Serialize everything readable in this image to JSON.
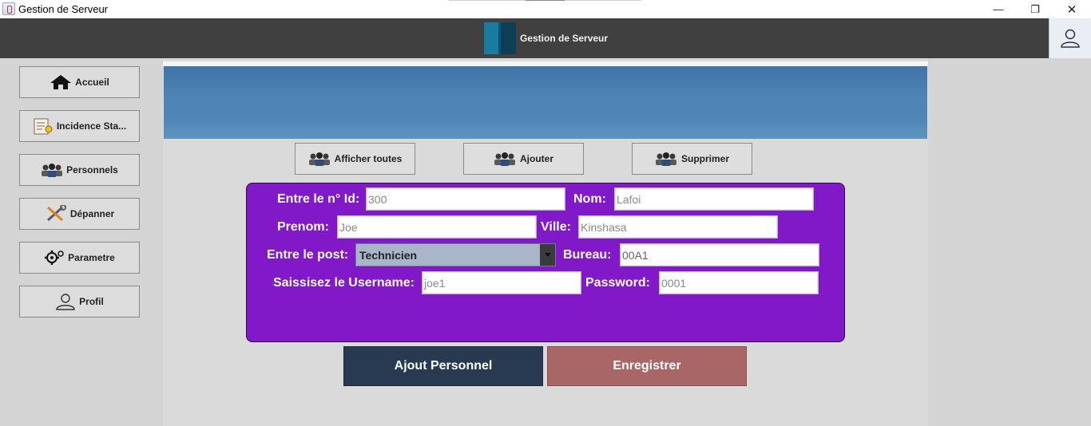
{
  "window": {
    "title": "Gestion de Serveur",
    "minimize_glyph": "—",
    "maximize_glyph": "❐",
    "close_glyph": "✕"
  },
  "header": {
    "title": "Gestion de Serveur"
  },
  "sidebar": {
    "items": [
      {
        "label": "Accueil",
        "icon": "home-icon"
      },
      {
        "label": "Incidence Sta...",
        "icon": "report-icon"
      },
      {
        "label": "Personnels",
        "icon": "people-icon"
      },
      {
        "label": "Dépanner",
        "icon": "tools-icon"
      },
      {
        "label": "Parametre",
        "icon": "settings-icon"
      },
      {
        "label": "Profil",
        "icon": "user-icon"
      }
    ]
  },
  "actions": {
    "show_all": "Afficher toutes",
    "add": "Ajouter",
    "delete": "Supprimer"
  },
  "form": {
    "id_label": "Entre le n° Id:",
    "id_value": "300",
    "nom_label": "Nom:",
    "nom_value": "Lafoi",
    "prenom_label": "Prenom:",
    "prenom_value": "Joe",
    "ville_label": "Ville:",
    "ville_value": "Kinshasa",
    "post_label": "Entre le post:",
    "post_value": "Technicien",
    "bureau_label": "Bureau:",
    "bureau_value": "00A1",
    "username_label": "Saissisez le Username:",
    "username_value": "joe1",
    "password_label": "Password:",
    "password_value": "0001"
  },
  "buttons": {
    "ajout_personnel": "Ajout Personnel",
    "enregistrer": "Enregistrer"
  },
  "colors": {
    "header_bg": "#404040",
    "form_bg": "#8119c9",
    "ajout_btn_bg": "#283a52",
    "enregistrer_btn_bg": "#a96667",
    "banner": "#4b84b5"
  }
}
